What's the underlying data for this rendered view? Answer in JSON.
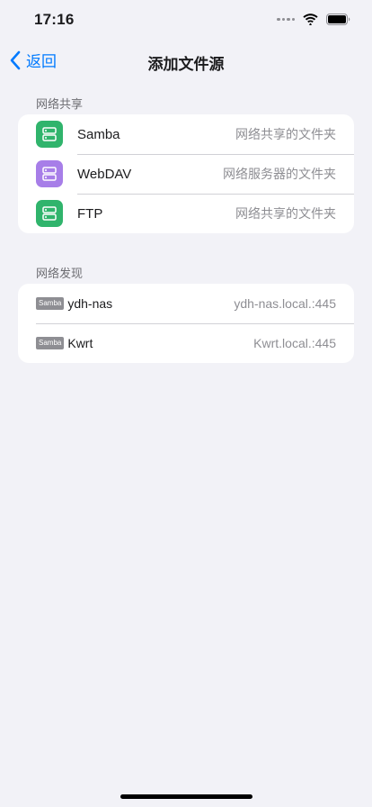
{
  "status_bar": {
    "time": "17:16"
  },
  "nav": {
    "back_label": "返回",
    "title": "添加文件源"
  },
  "network_share": {
    "header": "网络共享",
    "items": [
      {
        "title": "Samba",
        "detail": "网络共享的文件夹",
        "icon": "server-icon",
        "color": "#30b46c"
      },
      {
        "title": "WebDAV",
        "detail": "网络服务器的文件夹",
        "icon": "server-icon",
        "color": "#a77ee8"
      },
      {
        "title": "FTP",
        "detail": "网络共享的文件夹",
        "icon": "server-icon",
        "color": "#30b46c"
      }
    ]
  },
  "network_discovery": {
    "header": "网络发现",
    "items": [
      {
        "tag": "Samba",
        "title": "ydh-nas",
        "detail": "ydh-nas.local.:445"
      },
      {
        "tag": "Samba",
        "title": "Kwrt",
        "detail": "Kwrt.local.:445"
      }
    ]
  },
  "colors": {
    "accent": "#007aff",
    "background": "#f2f2f7"
  }
}
